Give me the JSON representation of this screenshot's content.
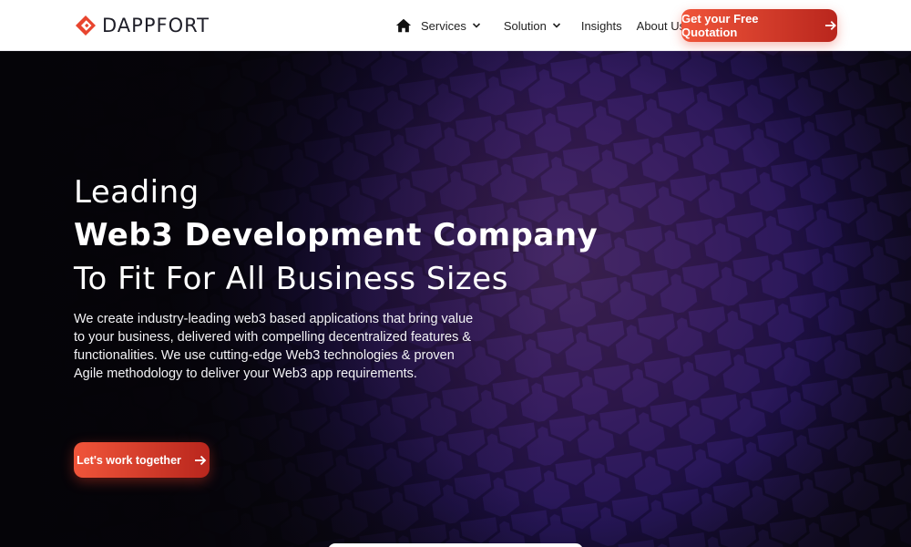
{
  "brand": {
    "name": "DAPPFORT",
    "accent": "#e8452f",
    "accent_dark": "#b9261d"
  },
  "nav": {
    "home_icon": "home-icon",
    "items": [
      {
        "label": "Services",
        "has_dropdown": true
      },
      {
        "label": "Solution",
        "has_dropdown": true
      },
      {
        "label": "Insights",
        "has_dropdown": false
      },
      {
        "label": "About Us",
        "has_dropdown": false
      }
    ],
    "cta_label": "Get your Free Quotation"
  },
  "hero": {
    "line1": "Leading",
    "line2": "Web3 Development Company",
    "line3": "To Fit For All Business Sizes",
    "description": "We create industry-leading web3 based applications that bring value to your business, delivered with compelling decentralized features & functionalities. We use cutting-edge Web3 technologies & proven Agile methodology to deliver your Web3 app requirements.",
    "cta_label": "Let's work together",
    "bg_colors": [
      "#0a0810",
      "#5b2bd6",
      "#a24bf0",
      "#c468ff"
    ]
  }
}
